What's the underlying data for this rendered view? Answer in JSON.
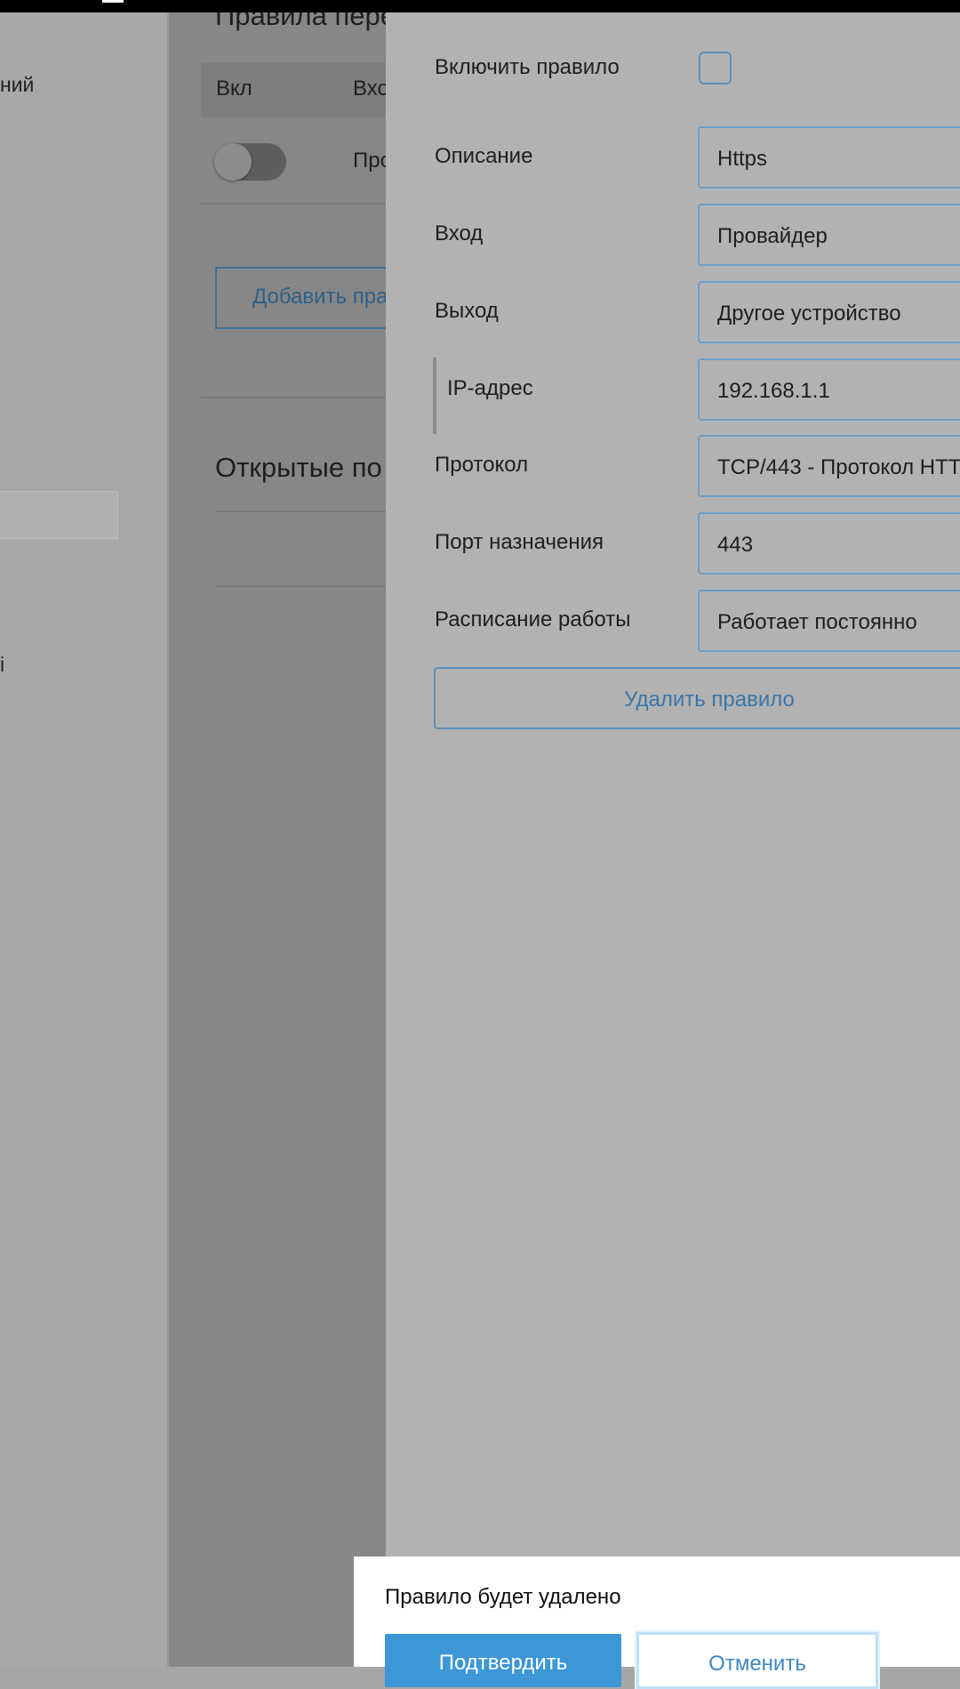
{
  "left_nav": {
    "item_fragment_1": "ний",
    "item_fragment_2": "i"
  },
  "main": {
    "section_title": "Правила пере",
    "table_headers": [
      "Вкл",
      "Вхо"
    ],
    "row_cell": "Про",
    "add_button_label": "Добавить пра",
    "open_ports_title": "Открытые по"
  },
  "panel": {
    "enable_rule_label": "Включить правило",
    "enable_rule_checked": false,
    "description_label": "Описание",
    "description_value": "Https",
    "input_label": "Вход",
    "input_value": "Провайдер",
    "output_label": "Выход",
    "output_value": "Другое устройство",
    "ip_label": "IP-адрес",
    "ip_value": "192.168.1.1",
    "protocol_label": "Протокол",
    "protocol_value": "TCP/443 - Протокол HTT",
    "dest_port_label": "Порт назначения",
    "dest_port_value": "443",
    "schedule_label": "Расписание работы",
    "schedule_value": "Работает постоянно",
    "delete_button_label": "Удалить правило"
  },
  "dialog": {
    "message": "Правило будет удалено",
    "confirm_label": "Подтвердить",
    "cancel_label": "Отменить"
  },
  "colors": {
    "accent": "#3d97d6",
    "link": "#3a76a8",
    "field_border": "#6f9dc3"
  }
}
